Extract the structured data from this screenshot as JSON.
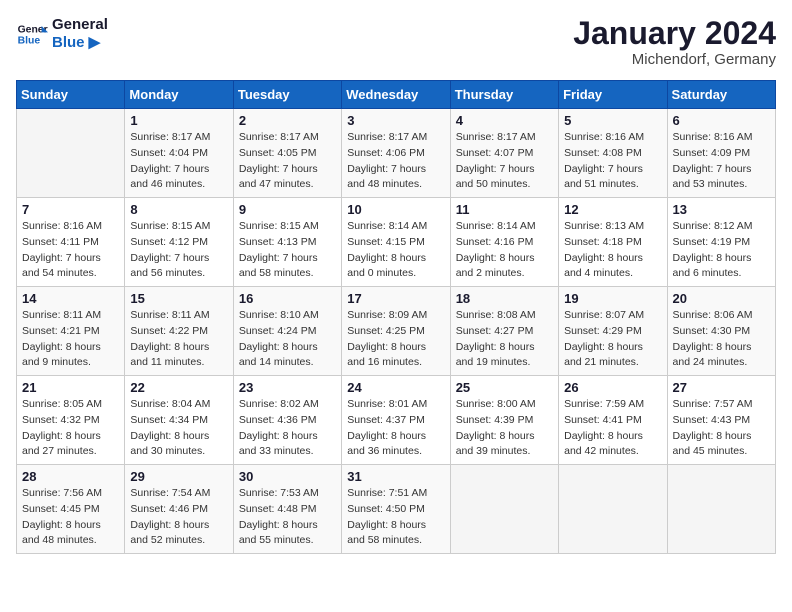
{
  "logo": {
    "text_general": "General",
    "text_blue": "Blue"
  },
  "title": "January 2024",
  "location": "Michendorf, Germany",
  "days_of_week": [
    "Sunday",
    "Monday",
    "Tuesday",
    "Wednesday",
    "Thursday",
    "Friday",
    "Saturday"
  ],
  "weeks": [
    [
      {
        "day": "",
        "sunrise": "",
        "sunset": "",
        "daylight": ""
      },
      {
        "day": "1",
        "sunrise": "Sunrise: 8:17 AM",
        "sunset": "Sunset: 4:04 PM",
        "daylight": "Daylight: 7 hours and 46 minutes."
      },
      {
        "day": "2",
        "sunrise": "Sunrise: 8:17 AM",
        "sunset": "Sunset: 4:05 PM",
        "daylight": "Daylight: 7 hours and 47 minutes."
      },
      {
        "day": "3",
        "sunrise": "Sunrise: 8:17 AM",
        "sunset": "Sunset: 4:06 PM",
        "daylight": "Daylight: 7 hours and 48 minutes."
      },
      {
        "day": "4",
        "sunrise": "Sunrise: 8:17 AM",
        "sunset": "Sunset: 4:07 PM",
        "daylight": "Daylight: 7 hours and 50 minutes."
      },
      {
        "day": "5",
        "sunrise": "Sunrise: 8:16 AM",
        "sunset": "Sunset: 4:08 PM",
        "daylight": "Daylight: 7 hours and 51 minutes."
      },
      {
        "day": "6",
        "sunrise": "Sunrise: 8:16 AM",
        "sunset": "Sunset: 4:09 PM",
        "daylight": "Daylight: 7 hours and 53 minutes."
      }
    ],
    [
      {
        "day": "7",
        "sunrise": "Sunrise: 8:16 AM",
        "sunset": "Sunset: 4:11 PM",
        "daylight": "Daylight: 7 hours and 54 minutes."
      },
      {
        "day": "8",
        "sunrise": "Sunrise: 8:15 AM",
        "sunset": "Sunset: 4:12 PM",
        "daylight": "Daylight: 7 hours and 56 minutes."
      },
      {
        "day": "9",
        "sunrise": "Sunrise: 8:15 AM",
        "sunset": "Sunset: 4:13 PM",
        "daylight": "Daylight: 7 hours and 58 minutes."
      },
      {
        "day": "10",
        "sunrise": "Sunrise: 8:14 AM",
        "sunset": "Sunset: 4:15 PM",
        "daylight": "Daylight: 8 hours and 0 minutes."
      },
      {
        "day": "11",
        "sunrise": "Sunrise: 8:14 AM",
        "sunset": "Sunset: 4:16 PM",
        "daylight": "Daylight: 8 hours and 2 minutes."
      },
      {
        "day": "12",
        "sunrise": "Sunrise: 8:13 AM",
        "sunset": "Sunset: 4:18 PM",
        "daylight": "Daylight: 8 hours and 4 minutes."
      },
      {
        "day": "13",
        "sunrise": "Sunrise: 8:12 AM",
        "sunset": "Sunset: 4:19 PM",
        "daylight": "Daylight: 8 hours and 6 minutes."
      }
    ],
    [
      {
        "day": "14",
        "sunrise": "Sunrise: 8:11 AM",
        "sunset": "Sunset: 4:21 PM",
        "daylight": "Daylight: 8 hours and 9 minutes."
      },
      {
        "day": "15",
        "sunrise": "Sunrise: 8:11 AM",
        "sunset": "Sunset: 4:22 PM",
        "daylight": "Daylight: 8 hours and 11 minutes."
      },
      {
        "day": "16",
        "sunrise": "Sunrise: 8:10 AM",
        "sunset": "Sunset: 4:24 PM",
        "daylight": "Daylight: 8 hours and 14 minutes."
      },
      {
        "day": "17",
        "sunrise": "Sunrise: 8:09 AM",
        "sunset": "Sunset: 4:25 PM",
        "daylight": "Daylight: 8 hours and 16 minutes."
      },
      {
        "day": "18",
        "sunrise": "Sunrise: 8:08 AM",
        "sunset": "Sunset: 4:27 PM",
        "daylight": "Daylight: 8 hours and 19 minutes."
      },
      {
        "day": "19",
        "sunrise": "Sunrise: 8:07 AM",
        "sunset": "Sunset: 4:29 PM",
        "daylight": "Daylight: 8 hours and 21 minutes."
      },
      {
        "day": "20",
        "sunrise": "Sunrise: 8:06 AM",
        "sunset": "Sunset: 4:30 PM",
        "daylight": "Daylight: 8 hours and 24 minutes."
      }
    ],
    [
      {
        "day": "21",
        "sunrise": "Sunrise: 8:05 AM",
        "sunset": "Sunset: 4:32 PM",
        "daylight": "Daylight: 8 hours and 27 minutes."
      },
      {
        "day": "22",
        "sunrise": "Sunrise: 8:04 AM",
        "sunset": "Sunset: 4:34 PM",
        "daylight": "Daylight: 8 hours and 30 minutes."
      },
      {
        "day": "23",
        "sunrise": "Sunrise: 8:02 AM",
        "sunset": "Sunset: 4:36 PM",
        "daylight": "Daylight: 8 hours and 33 minutes."
      },
      {
        "day": "24",
        "sunrise": "Sunrise: 8:01 AM",
        "sunset": "Sunset: 4:37 PM",
        "daylight": "Daylight: 8 hours and 36 minutes."
      },
      {
        "day": "25",
        "sunrise": "Sunrise: 8:00 AM",
        "sunset": "Sunset: 4:39 PM",
        "daylight": "Daylight: 8 hours and 39 minutes."
      },
      {
        "day": "26",
        "sunrise": "Sunrise: 7:59 AM",
        "sunset": "Sunset: 4:41 PM",
        "daylight": "Daylight: 8 hours and 42 minutes."
      },
      {
        "day": "27",
        "sunrise": "Sunrise: 7:57 AM",
        "sunset": "Sunset: 4:43 PM",
        "daylight": "Daylight: 8 hours and 45 minutes."
      }
    ],
    [
      {
        "day": "28",
        "sunrise": "Sunrise: 7:56 AM",
        "sunset": "Sunset: 4:45 PM",
        "daylight": "Daylight: 8 hours and 48 minutes."
      },
      {
        "day": "29",
        "sunrise": "Sunrise: 7:54 AM",
        "sunset": "Sunset: 4:46 PM",
        "daylight": "Daylight: 8 hours and 52 minutes."
      },
      {
        "day": "30",
        "sunrise": "Sunrise: 7:53 AM",
        "sunset": "Sunset: 4:48 PM",
        "daylight": "Daylight: 8 hours and 55 minutes."
      },
      {
        "day": "31",
        "sunrise": "Sunrise: 7:51 AM",
        "sunset": "Sunset: 4:50 PM",
        "daylight": "Daylight: 8 hours and 58 minutes."
      },
      {
        "day": "",
        "sunrise": "",
        "sunset": "",
        "daylight": ""
      },
      {
        "day": "",
        "sunrise": "",
        "sunset": "",
        "daylight": ""
      },
      {
        "day": "",
        "sunrise": "",
        "sunset": "",
        "daylight": ""
      }
    ]
  ]
}
